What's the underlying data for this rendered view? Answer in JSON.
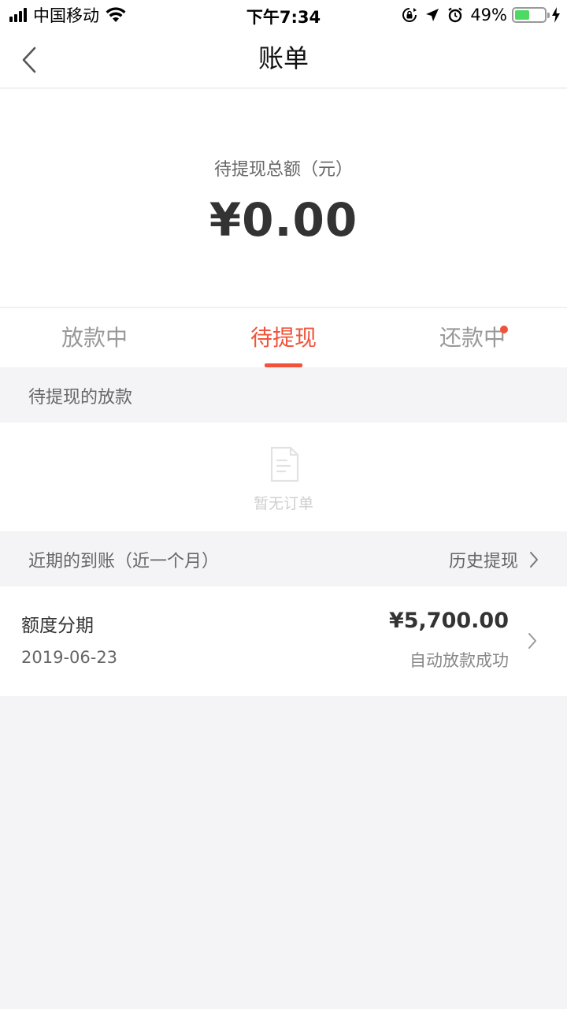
{
  "status_bar": {
    "carrier": "中国移动",
    "time": "下午7:34",
    "battery_percent": "49%",
    "battery_level": 0.49,
    "icons": [
      "signal-icon",
      "wifi-icon",
      "orientation-lock-icon",
      "location-icon",
      "alarm-icon",
      "battery-icon",
      "charging-icon"
    ]
  },
  "nav": {
    "title": "账单"
  },
  "summary": {
    "label": "待提现总额（元）",
    "amount": "¥0.00"
  },
  "tabs": [
    {
      "label": "放款中",
      "active": false,
      "has_dot": false
    },
    {
      "label": "待提现",
      "active": true,
      "has_dot": false
    },
    {
      "label": "还款中",
      "active": false,
      "has_dot": true
    }
  ],
  "pending_section": {
    "title": "待提现的放款",
    "empty_text": "暂无订单"
  },
  "recent_section": {
    "title": "近期的到账（近一个月）",
    "history_link": "历史提现"
  },
  "records": [
    {
      "title": "额度分期",
      "date": "2019-06-23",
      "amount": "¥5,700.00",
      "status": "自动放款成功"
    }
  ],
  "colors": {
    "accent": "#f0533a",
    "background": "#f4f4f6",
    "battery": "#4cd964"
  }
}
